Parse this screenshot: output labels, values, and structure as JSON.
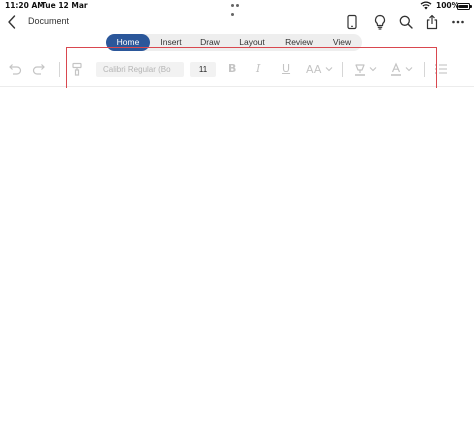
{
  "status_bar": {
    "time": "11:20 AM",
    "date": "Tue 12 Mar",
    "battery": "100%"
  },
  "title_bar": {
    "document_title": "Document",
    "icons": [
      "back-chevron-icon",
      "phone-view-icon",
      "lightbulb-icon",
      "search-icon",
      "share-icon",
      "more-icon"
    ]
  },
  "tabs": [
    {
      "label": "Home",
      "active": true
    },
    {
      "label": "Insert",
      "active": false
    },
    {
      "label": "Draw",
      "active": false
    },
    {
      "label": "Layout",
      "active": false
    },
    {
      "label": "Review",
      "active": false
    },
    {
      "label": "View",
      "active": false
    }
  ],
  "ribbon": {
    "font_name": "Calibri Regular (Bo",
    "font_size": "11",
    "bold_label": "B",
    "italic_label": "I",
    "underline_label": "U",
    "font_size_tool_label": "AA"
  },
  "colors": {
    "accent": "#2b579a",
    "highlight_border": "#d9484f",
    "disabled_icon": "#c4c4c4"
  }
}
